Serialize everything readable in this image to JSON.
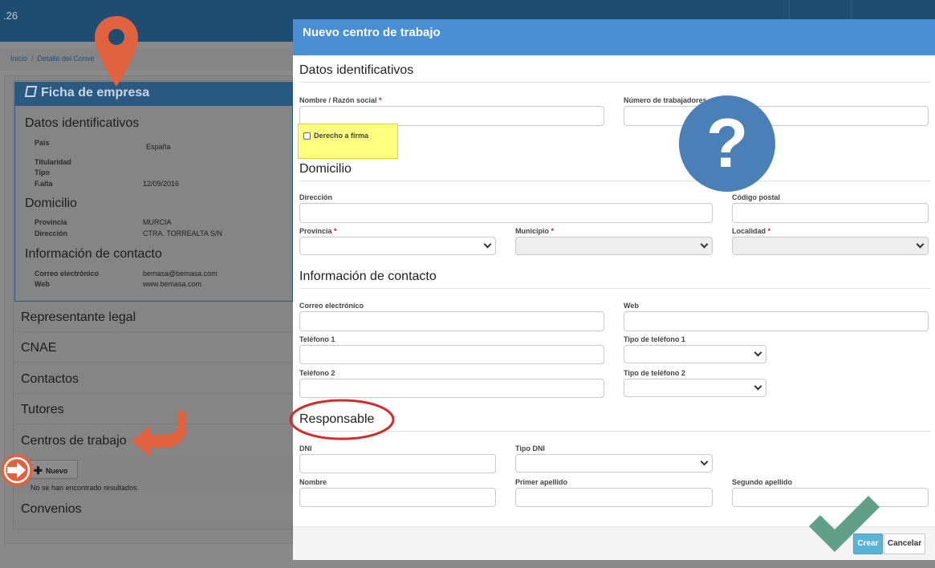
{
  "app": {
    "version": ".26"
  },
  "breadcrumb": {
    "home": "Inicio",
    "separator": "/",
    "current": "Detalle del Conve"
  },
  "ficha": {
    "title": "Ficha de empresa",
    "icon": "book-icon",
    "sections": {
      "datos": "Datos identificativos",
      "domicilio": "Domicilio",
      "contacto": "Información de contacto"
    },
    "fields": {
      "pais_label": "País",
      "pais_value": "España",
      "titularidad_label": "Titularidad",
      "tipo_label": "Tipo",
      "falta_label": "F.alta",
      "falta_value": "12/09/2016",
      "provincia_label": "Provincia",
      "provincia_value": "MURCIA",
      "direccion_label": "Dirección",
      "direccion_value": "CTRA. TORREALTA S/N",
      "correo_label": "Correo electrónico",
      "correo_value": "bemasa@bemasa.com",
      "web_label": "Web",
      "web_value": "www.bemasa.com"
    },
    "accordion": [
      "Representante legal",
      "CNAE",
      "Contactos",
      "Tutores",
      "Centros de trabajo",
      "Convenios"
    ],
    "nuevo_button": "Nuevo",
    "no_results": "No se han encontrado resultados."
  },
  "modal": {
    "title": "Nuevo centro de trabajo",
    "sections": {
      "datos": "Datos identificativos",
      "domicilio": "Domicilio",
      "contacto": "Información de contacto",
      "responsable": "Responsable"
    },
    "labels": {
      "nombre_razon": "Nombre / Razón social",
      "num_trabajadores": "Número de trabajadores",
      "derecho_firma": "Derecho a firma",
      "direccion": "Dirección",
      "codigo_postal": "Código postal",
      "provincia": "Provincia",
      "municipio": "Municipio",
      "localidad": "Localidad",
      "correo": "Correo electrónico",
      "web": "Web",
      "telefono1": "Teléfono 1",
      "tipo_telefono1": "Tipo de teléfono 1",
      "telefono2": "Teléfono 2",
      "tipo_telefono2": "Tipo de teléfono 2",
      "dni": "DNI",
      "tipo_dni": "Tipo DNI",
      "nombre": "Nombre",
      "primer_apellido": "Primer apellido",
      "segundo_apellido": "Segundo apellido"
    },
    "required_mark": "*",
    "buttons": {
      "crear": "Crear",
      "cancelar": "Cancelar"
    }
  },
  "annotations": {
    "question_mark": "?",
    "colors": {
      "pin": "#e0623f",
      "question": "#4a7fb8",
      "highlight": "#ffff7f",
      "circle": "#d42a2a",
      "check": "#5a9a83"
    }
  }
}
